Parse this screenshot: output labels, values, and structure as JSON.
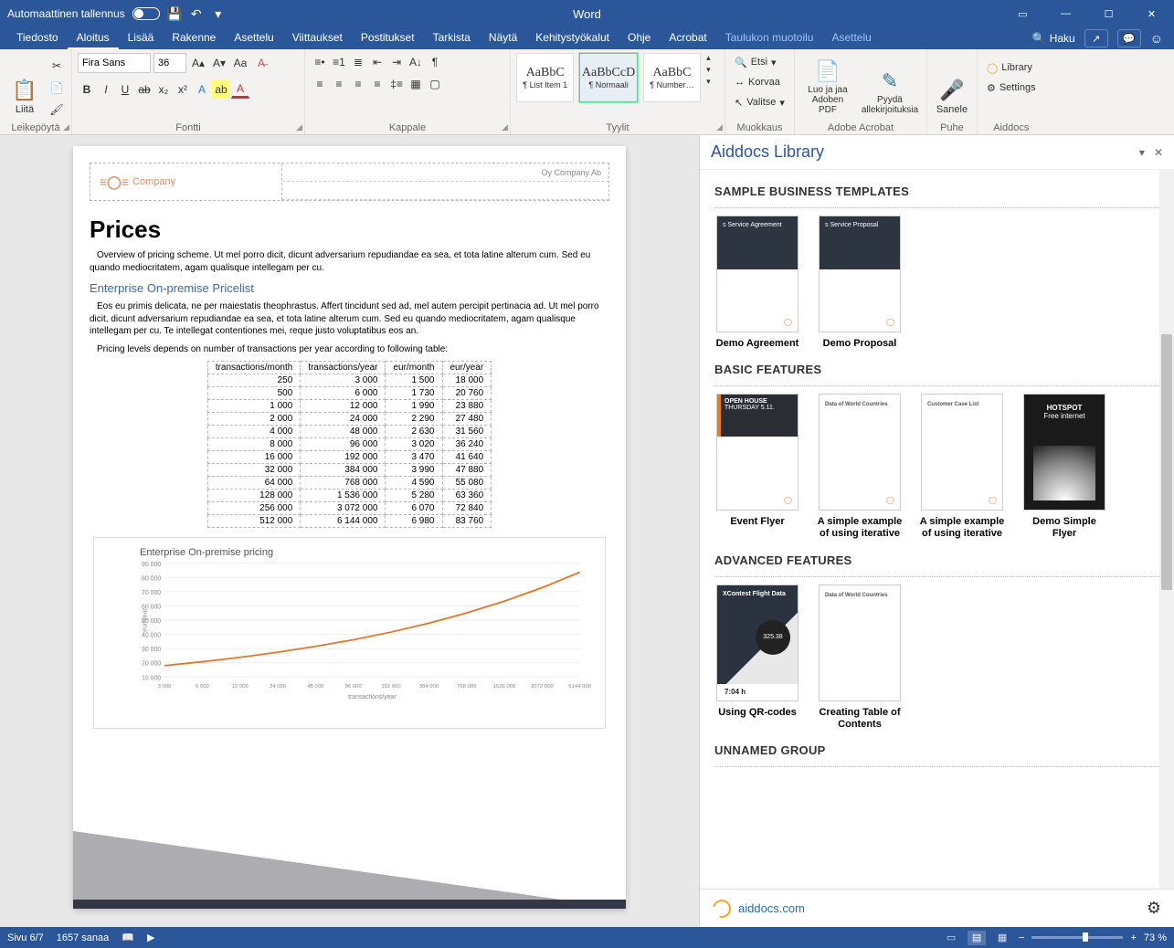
{
  "titlebar": {
    "autosave_label": "Automaattinen tallennus",
    "app_name": "Word"
  },
  "tabs": {
    "items": [
      "Tiedosto",
      "Aloitus",
      "Lisää",
      "Rakenne",
      "Asettelu",
      "Viittaukset",
      "Postitukset",
      "Tarkista",
      "Näytä",
      "Kehitystyökalut",
      "Ohje",
      "Acrobat"
    ],
    "contextual": [
      "Taulukon muotoilu",
      "Asettelu"
    ],
    "active_index": 1,
    "search_placeholder": "Haku"
  },
  "ribbon": {
    "clipboard": {
      "paste": "Liitä",
      "group": "Leikepöytä"
    },
    "font": {
      "family": "Fira Sans",
      "size": "36",
      "group": "Fontti"
    },
    "paragraph": {
      "group": "Kappale"
    },
    "styles": {
      "items": [
        {
          "preview": "AaBbC",
          "name": "¶ List Item 1"
        },
        {
          "preview": "AaBbCcD",
          "name": "¶ Normaali"
        },
        {
          "preview": "AaBbC",
          "name": "¶ Number…"
        }
      ],
      "group": "Tyylit",
      "selected": 1
    },
    "editing": {
      "find": "Etsi",
      "replace": "Korvaa",
      "select": "Valitse",
      "group": "Muokkaus"
    },
    "acrobat": {
      "create": "Luo ja jaa Adoben PDF",
      "sign": "Pyydä allekirjoituksia",
      "group": "Adobe Acrobat"
    },
    "voice": {
      "dictate": "Sanele",
      "group": "Puhe"
    },
    "aiddocs": {
      "library": "Library",
      "settings": "Settings",
      "group": "Aiddocs"
    }
  },
  "document": {
    "company": "Company",
    "header_right": "Oy Company Ab",
    "h1": "Prices",
    "p1": "Overview of pricing scheme. Ut mel porro dicit, dicunt adversarium repudiandae ea sea, et tota latine alterum cum. Sed eu quando mediocritatem, agam qualisque intellegam per cu.",
    "h2": "Enterprise On-premise Pricelist",
    "p2": "Eos eu primis delicata, ne per maiestatis theophrastus. Affert tincidunt sed ad, mel autem percipit pertinacia ad. Ut mel porro dicit, dicunt adversarium repudiandae ea sea, et tota latine alterum cum. Sed eu quando mediocritatem, agam qualisque intellegam per cu. Te intellegat contentiones mei, reque justo voluptatibus eos an.",
    "p3": "Pricing levels depends on number of transactions per year according to following table:",
    "table": {
      "headers": [
        "transactions/month",
        "transactions/year",
        "eur/month",
        "eur/year"
      ],
      "rows": [
        [
          "250",
          "3 000",
          "1 500",
          "18 000"
        ],
        [
          "500",
          "6 000",
          "1 730",
          "20 760"
        ],
        [
          "1 000",
          "12 000",
          "1 990",
          "23 880"
        ],
        [
          "2 000",
          "24 000",
          "2 290",
          "27 480"
        ],
        [
          "4 000",
          "48 000",
          "2 630",
          "31 560"
        ],
        [
          "8 000",
          "96 000",
          "3 020",
          "36 240"
        ],
        [
          "16 000",
          "192 000",
          "3 470",
          "41 640"
        ],
        [
          "32 000",
          "384 000",
          "3 990",
          "47 880"
        ],
        [
          "64 000",
          "768 000",
          "4 590",
          "55 080"
        ],
        [
          "128 000",
          "1 536 000",
          "5 280",
          "63 360"
        ],
        [
          "256 000",
          "3 072 000",
          "6 070",
          "72 840"
        ],
        [
          "512 000",
          "6 144 000",
          "6 980",
          "83 760"
        ]
      ]
    },
    "chart_title": "Enterprise On-premise pricing"
  },
  "chart_data": {
    "type": "line",
    "title": "Enterprise On-premise pricing",
    "xlabel": "transactions/year",
    "ylabel": "eur/year",
    "x_ticks": [
      "3 000",
      "6 000",
      "12 000",
      "24 000",
      "48 000",
      "96 000",
      "192 000",
      "384 000",
      "768 000",
      "1536 000",
      "3072 000",
      "6144 000"
    ],
    "y_ticks": [
      10000,
      20000,
      30000,
      40000,
      50000,
      60000,
      70000,
      80000,
      90000
    ],
    "xlim": [
      0,
      11
    ],
    "ylim": [
      10000,
      90000
    ],
    "series": [
      {
        "name": "eur/year",
        "color": "#e8742c",
        "x": [
          0,
          1,
          2,
          3,
          4,
          5,
          6,
          7,
          8,
          9,
          10,
          11
        ],
        "y": [
          18000,
          20760,
          23880,
          27480,
          31560,
          36240,
          41640,
          47880,
          55080,
          63360,
          72840,
          83760
        ]
      }
    ]
  },
  "pane": {
    "title": "Aiddocs Library",
    "sections": {
      "s1": "SAMPLE BUSINESS TEMPLATES",
      "s2": "BASIC FEATURES",
      "s3": "ADVANCED FEATURES",
      "s4": "UNNAMED GROUP"
    },
    "templates": {
      "t1": "Demo Agreement",
      "t1_thumb": "s Service Agreement",
      "t2": "Demo Proposal",
      "t2_thumb": "s Service Proposal",
      "t3": "Event Flyer",
      "t3_thumb1": "OPEN HOUSE",
      "t3_thumb2": "THURSDAY 5.11.",
      "t4": "A simple example of using iterative",
      "t4_thumb": "Data of World Countries",
      "t5": "A simple example of using iterative",
      "t5_thumb": "Customer Case List",
      "t6": "Demo Simple Flyer",
      "t6_thumb1": "HOTSPOT",
      "t6_thumb2": "Free internet",
      "t7": "Using QR-codes",
      "t7_thumb1": "XContest Flight Data",
      "t7_bubble": "325.38",
      "t7_timer": "7:04 h",
      "t8": "Creating Table of Contents",
      "t8_thumb": "Data of World Countries"
    },
    "footer_link": "aiddocs.com"
  },
  "statusbar": {
    "page": "Sivu 6/7",
    "words": "1657 sanaa",
    "zoom_out": "−",
    "zoom_in": "+",
    "zoom": "73 %"
  }
}
